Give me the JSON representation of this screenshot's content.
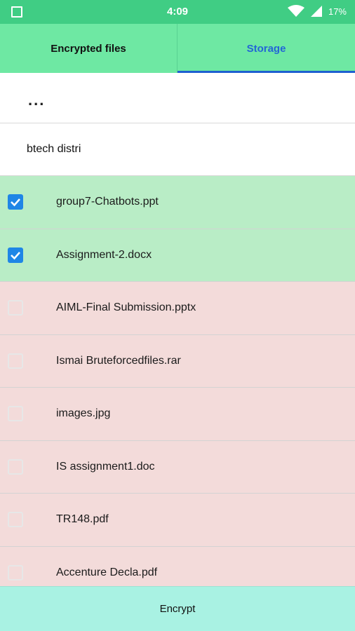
{
  "status_bar": {
    "time": "4:09",
    "battery": "17%"
  },
  "tabs": [
    {
      "label": "Encrypted files",
      "active": false
    },
    {
      "label": "Storage",
      "active": true
    }
  ],
  "path": {
    "parent": "..."
  },
  "folder": {
    "name": "btech distri"
  },
  "files": [
    {
      "name": "group7-Chatbots.ppt",
      "checked": true
    },
    {
      "name": "Assignment-2.docx",
      "checked": true
    },
    {
      "name": "AIML-Final Submission.pptx",
      "checked": false
    },
    {
      "name": "Ismai Bruteforcedfiles.rar",
      "checked": false
    },
    {
      "name": "images.jpg",
      "checked": false
    },
    {
      "name": "IS assignment1.doc",
      "checked": false
    },
    {
      "name": "TR148.pdf",
      "checked": false
    },
    {
      "name": "Accenture Decla.pdf",
      "checked": false
    }
  ],
  "encrypt_button": {
    "label": "Encrypt"
  },
  "colors": {
    "status_bar": "#40cd84",
    "tab_bg": "#6ee8a3",
    "tab_active_text": "#2366d6",
    "checked_row": "#b9edc6",
    "unchecked_row": "#f3dbda",
    "checkbox": "#1f86e6",
    "encrypt_button": "#a9f2e3"
  }
}
